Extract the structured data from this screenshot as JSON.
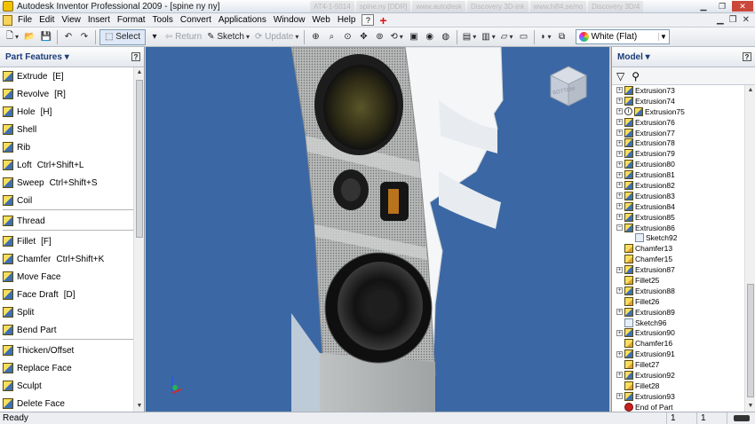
{
  "window": {
    "title": "Autodesk Inventor Professional 2009 - [spine ny ny]",
    "ghost_tabs": [
      "AT4-1-5014",
      "spine.ny [DDR]",
      "www.autodesk",
      "Discovery 3D-ink",
      "www.hifi4.se/no",
      "Discovery 3D/4"
    ]
  },
  "menu": {
    "items": [
      "File",
      "Edit",
      "View",
      "Insert",
      "Format",
      "Tools",
      "Convert",
      "Applications",
      "Window",
      "Web",
      "Help"
    ],
    "help_icon": "?",
    "add_icon": "+"
  },
  "toolbar": {
    "select_label": "Select",
    "return_label": "Return",
    "sketch_label": "Sketch",
    "update_label": "Update",
    "color_value": "White (Flat)"
  },
  "left_panel": {
    "title": "Part Features",
    "help_icon": "?",
    "tools": [
      {
        "label": "Extrude",
        "shortcut": "[E]"
      },
      {
        "label": "Revolve",
        "shortcut": "[R]"
      },
      {
        "label": "Hole",
        "shortcut": "[H]"
      },
      {
        "label": "Shell",
        "shortcut": ""
      },
      {
        "label": "Rib",
        "shortcut": ""
      },
      {
        "label": "Loft",
        "shortcut": "Ctrl+Shift+L"
      },
      {
        "label": "Sweep",
        "shortcut": "Ctrl+Shift+S"
      },
      {
        "label": "Coil",
        "shortcut": ""
      },
      {
        "label": "Thread",
        "shortcut": ""
      },
      {
        "label": "Fillet",
        "shortcut": "[F]"
      },
      {
        "label": "Chamfer",
        "shortcut": "Ctrl+Shift+K"
      },
      {
        "label": "Move Face",
        "shortcut": ""
      },
      {
        "label": "Face Draft",
        "shortcut": "[D]"
      },
      {
        "label": "Split",
        "shortcut": ""
      },
      {
        "label": "Bend Part",
        "shortcut": ""
      },
      {
        "label": "Thicken/Offset",
        "shortcut": ""
      },
      {
        "label": "Replace Face",
        "shortcut": ""
      },
      {
        "label": "Sculpt",
        "shortcut": ""
      },
      {
        "label": "Delete Face",
        "shortcut": ""
      }
    ]
  },
  "right_panel": {
    "title": "Model",
    "help_icon": "?",
    "filter_icon": "▽",
    "find_icon": "⚲",
    "tree": [
      {
        "label": "Extrusion73",
        "type": "extrusion",
        "exp": true
      },
      {
        "label": "Extrusion74",
        "type": "extrusion",
        "exp": true
      },
      {
        "label": "Extrusion75",
        "type": "extrusion",
        "exp": true,
        "warn": true
      },
      {
        "label": "Extrusion76",
        "type": "extrusion",
        "exp": true
      },
      {
        "label": "Extrusion77",
        "type": "extrusion",
        "exp": true
      },
      {
        "label": "Extrusion78",
        "type": "extrusion",
        "exp": true
      },
      {
        "label": "Extrusion79",
        "type": "extrusion",
        "exp": true
      },
      {
        "label": "Extrusion80",
        "type": "extrusion",
        "exp": true
      },
      {
        "label": "Extrusion81",
        "type": "extrusion",
        "exp": true
      },
      {
        "label": "Extrusion82",
        "type": "extrusion",
        "exp": true
      },
      {
        "label": "Extrusion83",
        "type": "extrusion",
        "exp": true
      },
      {
        "label": "Extrusion84",
        "type": "extrusion",
        "exp": true
      },
      {
        "label": "Extrusion85",
        "type": "extrusion",
        "exp": true
      },
      {
        "label": "Extrusion86",
        "type": "extrusion",
        "exp": true,
        "open": true
      },
      {
        "label": "Sketch92",
        "type": "sketch",
        "child": true
      },
      {
        "label": "Chamfer13",
        "type": "fillet"
      },
      {
        "label": "Chamfer15",
        "type": "fillet"
      },
      {
        "label": "Extrusion87",
        "type": "extrusion",
        "exp": true
      },
      {
        "label": "Fillet25",
        "type": "fillet"
      },
      {
        "label": "Extrusion88",
        "type": "extrusion",
        "exp": true
      },
      {
        "label": "Fillet26",
        "type": "fillet"
      },
      {
        "label": "Extrusion89",
        "type": "extrusion",
        "exp": true
      },
      {
        "label": "Sketch96",
        "type": "sketch"
      },
      {
        "label": "Extrusion90",
        "type": "extrusion",
        "exp": true
      },
      {
        "label": "Chamfer16",
        "type": "fillet"
      },
      {
        "label": "Extrusion91",
        "type": "extrusion",
        "exp": true
      },
      {
        "label": "Fillet27",
        "type": "fillet"
      },
      {
        "label": "Extrusion92",
        "type": "extrusion",
        "exp": true
      },
      {
        "label": "Fillet28",
        "type": "fillet"
      },
      {
        "label": "Extrusion93",
        "type": "extrusion",
        "exp": true
      },
      {
        "label": "End of Part",
        "type": "eop"
      }
    ]
  },
  "viewcube": {
    "face_label": "BOTTOM"
  },
  "status": {
    "text": "Ready",
    "cell1": "1",
    "cell2": "1"
  },
  "colors": {
    "viewport_bg": "#3b68a4",
    "panel_title": "#1c3c7a"
  }
}
